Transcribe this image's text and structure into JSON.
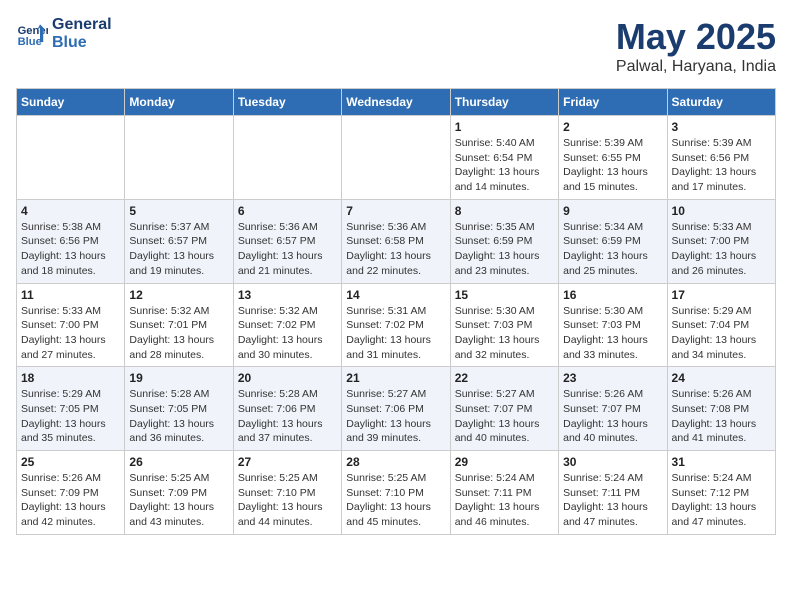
{
  "logo": {
    "line1": "General",
    "line2": "Blue"
  },
  "title": {
    "month": "May 2025",
    "location": "Palwal, Haryana, India"
  },
  "weekdays": [
    "Sunday",
    "Monday",
    "Tuesday",
    "Wednesday",
    "Thursday",
    "Friday",
    "Saturday"
  ],
  "weeks": [
    [
      {
        "day": "",
        "info": ""
      },
      {
        "day": "",
        "info": ""
      },
      {
        "day": "",
        "info": ""
      },
      {
        "day": "",
        "info": ""
      },
      {
        "day": "1",
        "info": "Sunrise: 5:40 AM\nSunset: 6:54 PM\nDaylight: 13 hours\nand 14 minutes."
      },
      {
        "day": "2",
        "info": "Sunrise: 5:39 AM\nSunset: 6:55 PM\nDaylight: 13 hours\nand 15 minutes."
      },
      {
        "day": "3",
        "info": "Sunrise: 5:39 AM\nSunset: 6:56 PM\nDaylight: 13 hours\nand 17 minutes."
      }
    ],
    [
      {
        "day": "4",
        "info": "Sunrise: 5:38 AM\nSunset: 6:56 PM\nDaylight: 13 hours\nand 18 minutes."
      },
      {
        "day": "5",
        "info": "Sunrise: 5:37 AM\nSunset: 6:57 PM\nDaylight: 13 hours\nand 19 minutes."
      },
      {
        "day": "6",
        "info": "Sunrise: 5:36 AM\nSunset: 6:57 PM\nDaylight: 13 hours\nand 21 minutes."
      },
      {
        "day": "7",
        "info": "Sunrise: 5:36 AM\nSunset: 6:58 PM\nDaylight: 13 hours\nand 22 minutes."
      },
      {
        "day": "8",
        "info": "Sunrise: 5:35 AM\nSunset: 6:59 PM\nDaylight: 13 hours\nand 23 minutes."
      },
      {
        "day": "9",
        "info": "Sunrise: 5:34 AM\nSunset: 6:59 PM\nDaylight: 13 hours\nand 25 minutes."
      },
      {
        "day": "10",
        "info": "Sunrise: 5:33 AM\nSunset: 7:00 PM\nDaylight: 13 hours\nand 26 minutes."
      }
    ],
    [
      {
        "day": "11",
        "info": "Sunrise: 5:33 AM\nSunset: 7:00 PM\nDaylight: 13 hours\nand 27 minutes."
      },
      {
        "day": "12",
        "info": "Sunrise: 5:32 AM\nSunset: 7:01 PM\nDaylight: 13 hours\nand 28 minutes."
      },
      {
        "day": "13",
        "info": "Sunrise: 5:32 AM\nSunset: 7:02 PM\nDaylight: 13 hours\nand 30 minutes."
      },
      {
        "day": "14",
        "info": "Sunrise: 5:31 AM\nSunset: 7:02 PM\nDaylight: 13 hours\nand 31 minutes."
      },
      {
        "day": "15",
        "info": "Sunrise: 5:30 AM\nSunset: 7:03 PM\nDaylight: 13 hours\nand 32 minutes."
      },
      {
        "day": "16",
        "info": "Sunrise: 5:30 AM\nSunset: 7:03 PM\nDaylight: 13 hours\nand 33 minutes."
      },
      {
        "day": "17",
        "info": "Sunrise: 5:29 AM\nSunset: 7:04 PM\nDaylight: 13 hours\nand 34 minutes."
      }
    ],
    [
      {
        "day": "18",
        "info": "Sunrise: 5:29 AM\nSunset: 7:05 PM\nDaylight: 13 hours\nand 35 minutes."
      },
      {
        "day": "19",
        "info": "Sunrise: 5:28 AM\nSunset: 7:05 PM\nDaylight: 13 hours\nand 36 minutes."
      },
      {
        "day": "20",
        "info": "Sunrise: 5:28 AM\nSunset: 7:06 PM\nDaylight: 13 hours\nand 37 minutes."
      },
      {
        "day": "21",
        "info": "Sunrise: 5:27 AM\nSunset: 7:06 PM\nDaylight: 13 hours\nand 39 minutes."
      },
      {
        "day": "22",
        "info": "Sunrise: 5:27 AM\nSunset: 7:07 PM\nDaylight: 13 hours\nand 40 minutes."
      },
      {
        "day": "23",
        "info": "Sunrise: 5:26 AM\nSunset: 7:07 PM\nDaylight: 13 hours\nand 40 minutes."
      },
      {
        "day": "24",
        "info": "Sunrise: 5:26 AM\nSunset: 7:08 PM\nDaylight: 13 hours\nand 41 minutes."
      }
    ],
    [
      {
        "day": "25",
        "info": "Sunrise: 5:26 AM\nSunset: 7:09 PM\nDaylight: 13 hours\nand 42 minutes."
      },
      {
        "day": "26",
        "info": "Sunrise: 5:25 AM\nSunset: 7:09 PM\nDaylight: 13 hours\nand 43 minutes."
      },
      {
        "day": "27",
        "info": "Sunrise: 5:25 AM\nSunset: 7:10 PM\nDaylight: 13 hours\nand 44 minutes."
      },
      {
        "day": "28",
        "info": "Sunrise: 5:25 AM\nSunset: 7:10 PM\nDaylight: 13 hours\nand 45 minutes."
      },
      {
        "day": "29",
        "info": "Sunrise: 5:24 AM\nSunset: 7:11 PM\nDaylight: 13 hours\nand 46 minutes."
      },
      {
        "day": "30",
        "info": "Sunrise: 5:24 AM\nSunset: 7:11 PM\nDaylight: 13 hours\nand 47 minutes."
      },
      {
        "day": "31",
        "info": "Sunrise: 5:24 AM\nSunset: 7:12 PM\nDaylight: 13 hours\nand 47 minutes."
      }
    ]
  ]
}
